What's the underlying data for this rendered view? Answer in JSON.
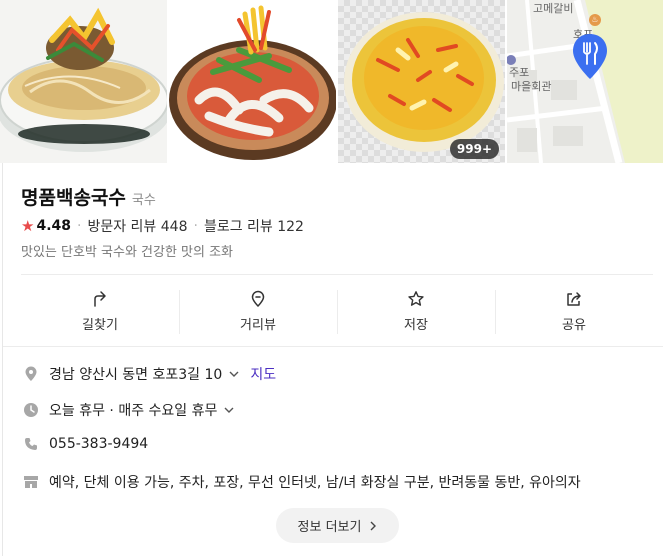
{
  "gallery": {
    "more_badge": "999+",
    "map": {
      "place_label_1": "고메갈비",
      "place_label_2": "호포",
      "place_label_3": "주포",
      "place_label_4": "마을회관"
    }
  },
  "place": {
    "name": "명품백송국수",
    "category": "국수",
    "rating": "4.48",
    "visitor_reviews": "방문자 리뷰 448",
    "blog_reviews": "블로그 리뷰 122",
    "description": "맛있는 단호박 국수와 건강한 맛의 조화"
  },
  "actions": [
    {
      "label": "길찾기",
      "icon": "directions-icon"
    },
    {
      "label": "거리뷰",
      "icon": "street-view-icon"
    },
    {
      "label": "저장",
      "icon": "star-icon"
    },
    {
      "label": "공유",
      "icon": "share-icon"
    }
  ],
  "info": {
    "address": "경남 양산시 동면 호포3길 10",
    "map_link": "지도",
    "hours": "오늘 휴무 · 매주 수요일 휴무",
    "phone": "055-383-9494",
    "amenities": "예약, 단체 이용 가능, 주차, 포장, 무선 인터넷, 남/녀 화장실 구분, 반려동물 동반, 유아의자"
  },
  "more_info_label": "정보 더보기",
  "colors": {
    "rating_star": "#e84b4b",
    "link": "#4b2fc2",
    "map_pin": "#3b6ff0"
  }
}
